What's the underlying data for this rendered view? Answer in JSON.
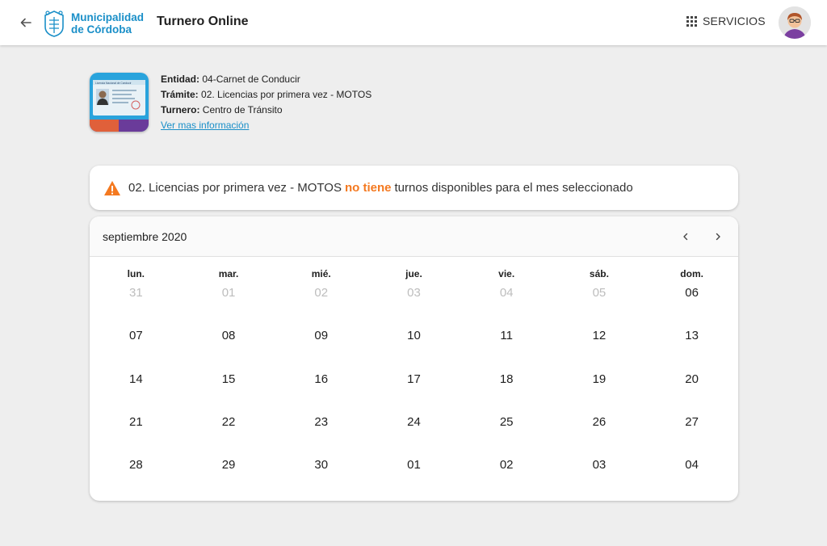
{
  "header": {
    "logo_line1": "Municipalidad",
    "logo_line2": "de Córdoba",
    "title": "Turnero Online",
    "servicios_label": "SERVICIOS"
  },
  "entity": {
    "card_title": "Licencia Nacional de Conducir",
    "entidad_label": "Entidad:",
    "entidad_value": "04-Carnet de Conducir",
    "tramite_label": "Trámite:",
    "tramite_value": "02. Licencias por primera vez - MOTOS",
    "turnero_label": "Turnero:",
    "turnero_value": "Centro de Tránsito",
    "more_link": "Ver mas información"
  },
  "alert": {
    "prefix": "02. Licencias por primera vez - MOTOS",
    "highlight": "no tiene",
    "suffix": "turnos disponibles para el mes seleccionado",
    "highlight_color": "#f47920"
  },
  "calendar": {
    "month_label": "septiembre 2020",
    "weekdays": [
      "lun.",
      "mar.",
      "mié.",
      "jue.",
      "vie.",
      "sáb.",
      "dom."
    ],
    "weeks": [
      [
        {
          "d": "31",
          "muted": true
        },
        {
          "d": "01",
          "muted": true
        },
        {
          "d": "02",
          "muted": true
        },
        {
          "d": "03",
          "muted": true
        },
        {
          "d": "04",
          "muted": true
        },
        {
          "d": "05",
          "muted": true
        },
        {
          "d": "06",
          "muted": false
        }
      ],
      [
        {
          "d": "07",
          "muted": false
        },
        {
          "d": "08",
          "muted": false
        },
        {
          "d": "09",
          "muted": false
        },
        {
          "d": "10",
          "muted": false
        },
        {
          "d": "11",
          "muted": false
        },
        {
          "d": "12",
          "muted": false
        },
        {
          "d": "13",
          "muted": false
        }
      ],
      [
        {
          "d": "14",
          "muted": false
        },
        {
          "d": "15",
          "muted": false
        },
        {
          "d": "16",
          "muted": false
        },
        {
          "d": "17",
          "muted": false
        },
        {
          "d": "18",
          "muted": false
        },
        {
          "d": "19",
          "muted": false
        },
        {
          "d": "20",
          "muted": false
        }
      ],
      [
        {
          "d": "21",
          "muted": false
        },
        {
          "d": "22",
          "muted": false
        },
        {
          "d": "23",
          "muted": false
        },
        {
          "d": "24",
          "muted": false
        },
        {
          "d": "25",
          "muted": false
        },
        {
          "d": "26",
          "muted": false
        },
        {
          "d": "27",
          "muted": false
        }
      ],
      [
        {
          "d": "28",
          "muted": false
        },
        {
          "d": "29",
          "muted": false
        },
        {
          "d": "30",
          "muted": false
        },
        {
          "d": "01",
          "muted": false
        },
        {
          "d": "02",
          "muted": false
        },
        {
          "d": "03",
          "muted": false
        },
        {
          "d": "04",
          "muted": false
        }
      ]
    ]
  },
  "icons": {
    "back": "arrow-left-icon",
    "servicios": "apps-grid-icon",
    "warning": "warning-triangle-icon",
    "prev": "chevron-left-icon",
    "next": "chevron-right-icon"
  },
  "colors": {
    "brand": "#1a8fc8",
    "accent": "#f47920",
    "background": "#eeeeee"
  }
}
